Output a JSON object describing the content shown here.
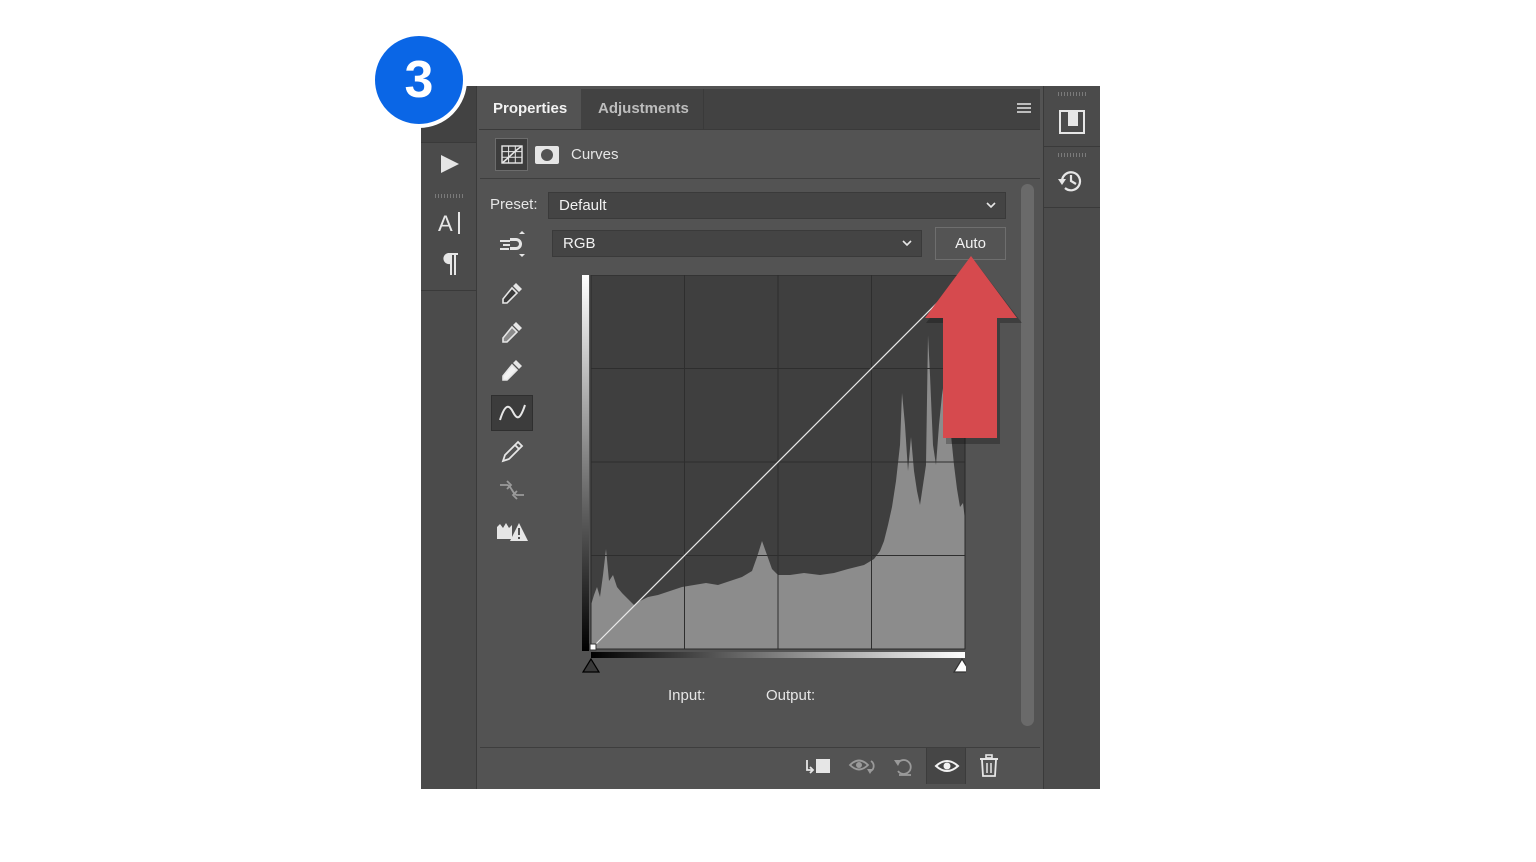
{
  "step_badge": "3",
  "tabs": [
    {
      "label": "Properties",
      "active": true
    },
    {
      "label": "Adjustments",
      "active": false
    }
  ],
  "header": {
    "title": "Curves"
  },
  "preset": {
    "label": "Preset:",
    "value": "Default"
  },
  "channel": {
    "value": "RGB"
  },
  "auto_button": {
    "label": "Auto"
  },
  "readout": {
    "input_label": "Input:",
    "output_label": "Output:"
  },
  "icons": {
    "left_strip": [
      "play-icon",
      "character-icon",
      "paragraph-icon"
    ],
    "right_strip": [
      "libraries-icon",
      "history-icon"
    ],
    "tools": [
      "on-image-adjust-icon",
      "black-point-eyedropper-icon",
      "gray-point-eyedropper-icon",
      "white-point-eyedropper-icon",
      "curve-edit-icon",
      "pencil-icon",
      "smooth-icon",
      "clipping-warning-icon"
    ],
    "bottom": [
      "clip-to-layer-icon",
      "view-previous-icon",
      "reset-icon",
      "visibility-icon",
      "delete-icon"
    ]
  },
  "colors": {
    "badge": "#0a66e6",
    "annotation_arrow": "#d64a4e",
    "panel_bg": "#535353"
  }
}
